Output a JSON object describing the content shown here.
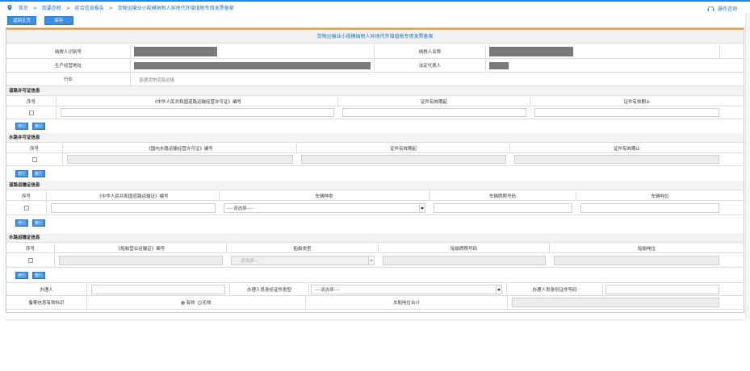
{
  "breadcrumb": {
    "items": [
      "首页",
      ">",
      "我要办税",
      ">",
      "综合信息报告",
      ">",
      "货物运输业小规模纳税人异地代开增值税专用发票备案"
    ]
  },
  "help": {
    "label": "操作咨询"
  },
  "toolbar": {
    "back_label": "返回主页",
    "save_label": "保存"
  },
  "form": {
    "title": "货物运输业小规模纳税人异地代开增值税专用发票备案",
    "taxpayer_id_label": "纳税人识别号",
    "taxpayer_name_label": "纳税人名称",
    "address_label": "生产经营地址",
    "legal_rep_label": "法定代表人",
    "industry_label": "行业",
    "industry_value": "普通货物道路运输"
  },
  "road_permit": {
    "section_title": "道路许可证信息",
    "columns": [
      "序号",
      "《中华人民共和国道路运输经营许可证》编号",
      "证件有效期起",
      "证件有效期止"
    ]
  },
  "water_permit": {
    "section_title": "水路许可证信息",
    "columns": [
      "序号",
      "《国内水路运输经营许可证》编号",
      "证件有效期起",
      "证件有效期止"
    ]
  },
  "road_transport": {
    "section_title": "道路运输证信息",
    "columns": [
      "序号",
      "《中华人民共和国道路运输证》编号",
      "车辆种类",
      "车辆牌照号码",
      "车辆吨位"
    ],
    "select_placeholder": "----请选择----"
  },
  "water_transport": {
    "section_title": "水路运输证信息",
    "columns": [
      "序号",
      "《船舶营业运输证》编号",
      "船舶类型",
      "船舶牌照号码",
      "船舶吨位"
    ],
    "select_placeholder": "----请选择----"
  },
  "row_buttons": {
    "add": "增行",
    "delete": "删行"
  },
  "footer": {
    "handler_label": "办理人",
    "id_type_label": "办理人员身份证件类型",
    "id_type_placeholder": "----请选择----",
    "id_number_label": "办理人员身份证件号码",
    "valid_flag_label": "备案信息有效标识",
    "valid_option": "有效",
    "invalid_option": "无效",
    "tonnage_total_label": "车船吨位合计"
  },
  "colors": {
    "accent": "#3b8ee6",
    "link": "#1a73c9",
    "orange_bar": "#f0a030"
  }
}
